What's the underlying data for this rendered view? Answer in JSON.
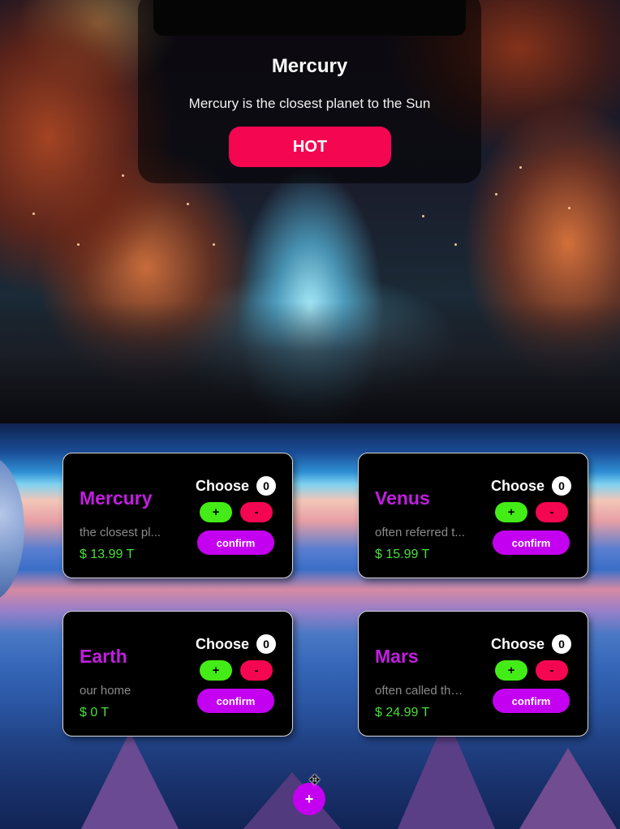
{
  "hero": {
    "planet_name": "Mercury",
    "description": "Mercury is the closest planet to the Sun",
    "badge_label": "HOT"
  },
  "products": [
    {
      "name": "Mercury",
      "description": "the closest pl...",
      "price": "$ 13.99 T",
      "choose_label": "Choose",
      "count": "0",
      "plus_label": "+",
      "minus_label": "-",
      "confirm_label": "confirm"
    },
    {
      "name": "Venus",
      "description": "often referred t...",
      "price": "$ 15.99 T",
      "choose_label": "Choose",
      "count": "0",
      "plus_label": "+",
      "minus_label": "-",
      "confirm_label": "confirm"
    },
    {
      "name": "Earth",
      "description": "our home",
      "price": "$ 0 T",
      "choose_label": "Choose",
      "count": "0",
      "plus_label": "+",
      "minus_label": "-",
      "confirm_label": "confirm"
    },
    {
      "name": "Mars",
      "description": "often called the ...",
      "price": "$ 24.99 T",
      "choose_label": "Choose",
      "count": "0",
      "plus_label": "+",
      "minus_label": "-",
      "confirm_label": "confirm"
    }
  ],
  "fab": {
    "label": "+"
  },
  "cursor": {
    "icon": "move-cursor-icon"
  },
  "colors": {
    "accent_purple": "#c400f0",
    "hot_pink": "#f50651",
    "plus_green": "#44ec17",
    "price_green": "#46e03a",
    "card_bg": "#000000"
  }
}
